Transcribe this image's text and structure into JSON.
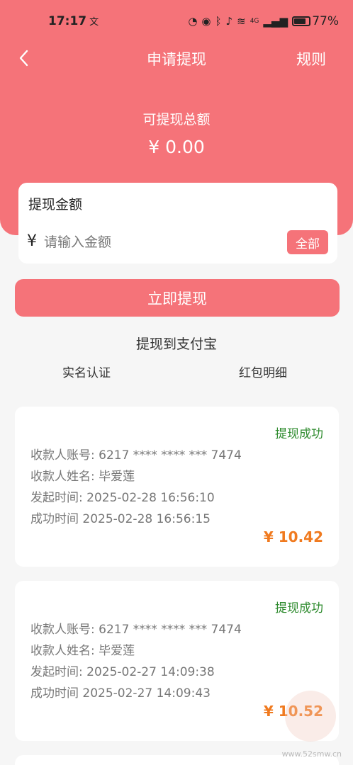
{
  "status_bar": {
    "time": "17:17",
    "time_suffix": "文",
    "icons": [
      "alarm-icon",
      "eye-icon",
      "bluetooth-icon",
      "mute-icon",
      "wifi-icon",
      "signal-icon"
    ],
    "network_label": "4G",
    "battery_percent": "77%"
  },
  "nav": {
    "title": "申请提现",
    "rule_label": "规则"
  },
  "summary": {
    "label": "可提现总额",
    "amount": "¥ 0.00"
  },
  "input": {
    "title": "提现金额",
    "currency": "¥",
    "placeholder": "请输入金额",
    "all_label": "全部"
  },
  "withdraw_button": "立即提现",
  "destination": "提现到支付宝",
  "links": {
    "verify": "实名认证",
    "detail": "红包明细"
  },
  "records": [
    {
      "status": "提现成功",
      "account": "收款人账号:  6217 **** **** *** 7474",
      "name": "收款人姓名:  毕爱莲",
      "start_time": "发起时间:  2025-02-28 16:56:10",
      "success_time": "成功时间 2025-02-28 16:56:15",
      "amount": "¥ 10.42"
    },
    {
      "status": "提现成功",
      "account": "收款人账号:  6217 **** **** *** 7474",
      "name": "收款人姓名:  毕爱莲",
      "start_time": "发起时间:  2025-02-27 14:09:38",
      "success_time": "成功时间 2025-02-27 14:09:43",
      "amount": "¥ 10.52"
    }
  ],
  "watermark_text": "www.52smw.cn",
  "colors": {
    "primary": "#f57379",
    "success": "#2e8b2e",
    "amount": "#f07a1f"
  }
}
